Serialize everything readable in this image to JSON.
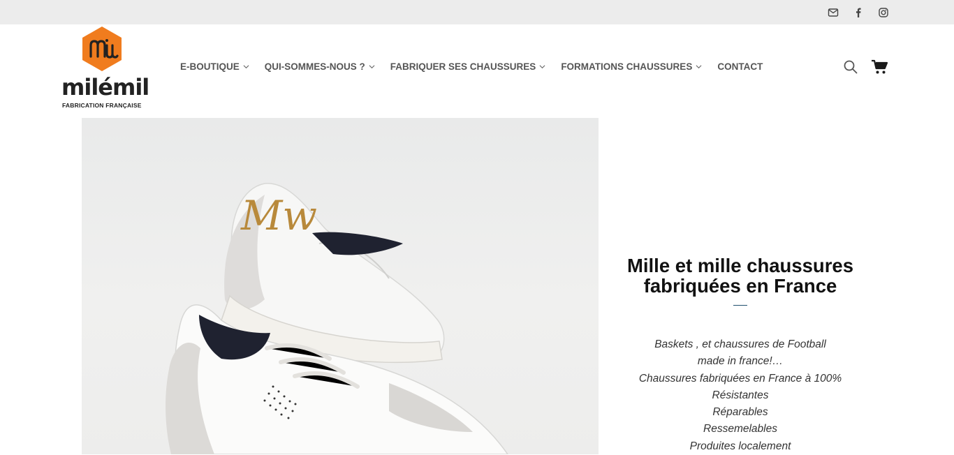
{
  "topbar": {
    "icons": [
      "envelope-icon",
      "facebook-icon",
      "instagram-icon"
    ]
  },
  "brand": {
    "name": "milémil",
    "tagline": "FABRICATION FRANÇAISE",
    "accent": "#f07c1e",
    "dark": "#222222"
  },
  "nav": {
    "items": [
      {
        "label": "E-BOUTIQUE",
        "has_dropdown": true
      },
      {
        "label": "QUI-SOMMES-NOUS ?",
        "has_dropdown": true
      },
      {
        "label": "FABRIQUER SES CHAUSSURES",
        "has_dropdown": true
      },
      {
        "label": "FORMATIONS CHAUSSURES",
        "has_dropdown": true
      },
      {
        "label": "CONTACT",
        "has_dropdown": false
      }
    ]
  },
  "header_icons": [
    "search-icon",
    "cart-icon"
  ],
  "hero": {
    "image_alt": "white sneakers",
    "title": "Mille et mille chaussures fabriquées en France",
    "lines": [
      "Baskets , et chaussures de Football",
      "made in france!…",
      "Chaussures fabriquées en France à 100%",
      "Résistantes",
      "Réparables",
      "Ressemelables",
      "Produites localement"
    ]
  }
}
